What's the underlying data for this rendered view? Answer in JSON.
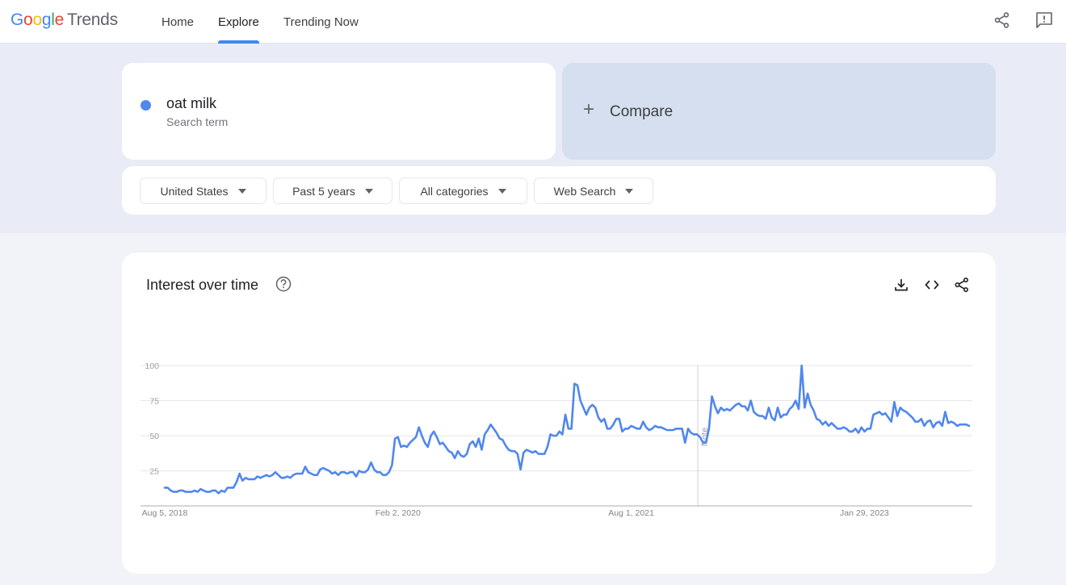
{
  "header": {
    "logo": {
      "google_letters": [
        "G",
        "o",
        "o",
        "g",
        "l",
        "e"
      ],
      "product": "Trends"
    },
    "nav": [
      {
        "label": "Home",
        "active": false
      },
      {
        "label": "Explore",
        "active": true
      },
      {
        "label": "Trending Now",
        "active": false
      }
    ],
    "icons": [
      "share-icon",
      "feedback-icon"
    ]
  },
  "search": {
    "term": "oat milk",
    "term_type": "Search term",
    "term_color": "#5087ee",
    "compare_label": "Compare",
    "compare_icon": "+"
  },
  "filters": [
    {
      "label": "United States"
    },
    {
      "label": "Past 5 years"
    },
    {
      "label": "All categories"
    },
    {
      "label": "Web Search"
    }
  ],
  "panel": {
    "title": "Interest over time",
    "icons": [
      "help-icon",
      "download-icon",
      "embed-icon",
      "share-icon"
    ]
  },
  "chart_data": {
    "type": "line",
    "title": "Interest over time",
    "xlabel": "",
    "ylabel": "",
    "ylim": [
      0,
      100
    ],
    "y_ticks": [
      25,
      50,
      75,
      100
    ],
    "y_tick_labels": [
      "25",
      "50",
      "75",
      "100"
    ],
    "x_tick_labels": [
      "Aug 5, 2018",
      "Feb 2, 2020",
      "Aug 1, 2021",
      "Jan 29, 2023"
    ],
    "x_tick_week_index": [
      0,
      78,
      156,
      234
    ],
    "grid": true,
    "legend": "none",
    "annotation": {
      "label": "Note",
      "week_index": 178
    },
    "x_start": "Aug 5, 2018",
    "x_step": "1 week",
    "series": [
      {
        "name": "oat milk",
        "color": "#5087ee",
        "values": [
          13,
          13,
          11,
          10,
          10,
          11,
          11,
          10,
          10,
          10,
          11,
          10,
          12,
          11,
          10,
          10,
          11,
          11,
          9,
          11,
          10,
          13,
          13,
          13,
          17,
          23,
          18,
          20,
          19,
          19,
          19,
          21,
          20,
          21,
          22,
          21,
          22,
          24,
          22,
          20,
          20,
          21,
          20,
          22,
          23,
          23,
          23,
          28,
          24,
          23,
          22,
          22,
          26,
          27,
          26,
          25,
          23,
          24,
          22,
          24,
          24,
          23,
          24,
          24,
          21,
          25,
          24,
          24,
          26,
          31,
          26,
          24,
          24,
          22,
          22,
          24,
          29,
          48,
          49,
          42,
          43,
          42,
          45,
          47,
          49,
          56,
          50,
          45,
          42,
          50,
          53,
          49,
          44,
          45,
          42,
          39,
          38,
          34,
          39,
          36,
          35,
          37,
          44,
          46,
          42,
          48,
          40,
          51,
          54,
          58,
          55,
          52,
          48,
          47,
          43,
          40,
          39,
          39,
          37,
          26,
          38,
          40,
          39,
          38,
          39,
          37,
          37,
          37,
          42,
          51,
          50,
          50,
          53,
          51,
          65,
          55,
          55,
          87,
          86,
          75,
          70,
          65,
          70,
          72,
          70,
          63,
          60,
          62,
          55,
          55,
          58,
          62,
          62,
          53,
          55,
          55,
          57,
          56,
          55,
          55,
          60,
          56,
          54,
          55,
          57,
          56,
          56,
          55,
          54,
          54,
          54,
          55,
          55,
          55,
          45,
          55,
          52,
          51,
          51,
          49,
          45,
          45,
          55,
          78,
          71,
          66,
          70,
          68,
          69,
          68,
          70,
          72,
          73,
          71,
          71,
          68,
          75,
          67,
          65,
          64,
          64,
          62,
          70,
          63,
          61,
          70,
          63,
          65,
          65,
          69,
          71,
          75,
          69,
          100,
          70,
          80,
          72,
          68,
          62,
          61,
          58,
          60,
          57,
          59,
          57,
          55,
          55,
          56,
          55,
          53,
          53,
          55,
          52,
          56,
          53,
          55,
          55,
          65,
          66,
          67,
          65,
          66,
          63,
          60,
          74,
          64,
          70,
          68,
          67,
          65,
          63,
          60,
          60,
          62,
          57,
          60,
          61,
          56,
          59,
          60,
          57,
          67,
          59,
          60,
          59,
          57,
          58,
          58,
          58,
          57
        ]
      }
    ]
  }
}
